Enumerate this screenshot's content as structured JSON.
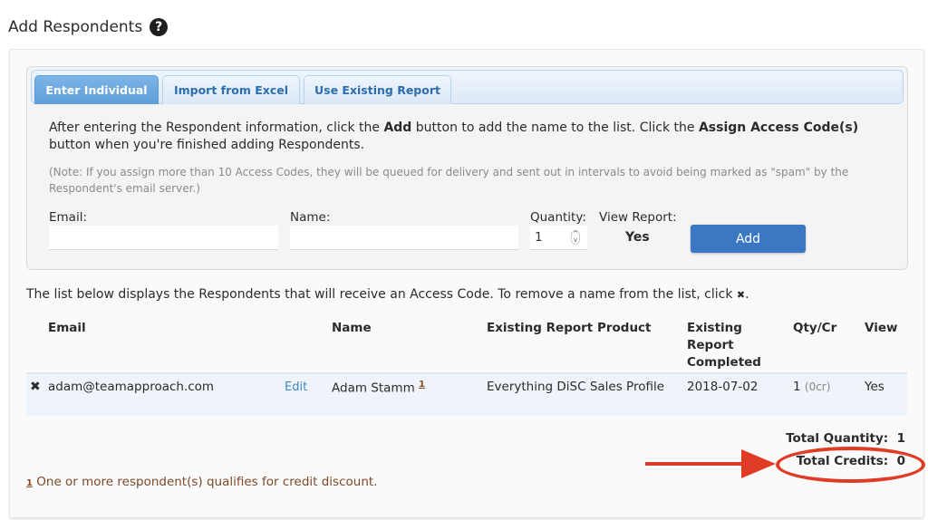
{
  "page": {
    "title": "Add Respondents",
    "help_icon": "question-circle-icon"
  },
  "tabs": [
    {
      "label": "Enter Individual",
      "active": true
    },
    {
      "label": "Import from Excel",
      "active": false
    },
    {
      "label": "Use Existing Report",
      "active": false
    }
  ],
  "instructions": {
    "part1": "After entering the Respondent information, click the ",
    "bold1": "Add",
    "part2": " button to add the name to the list. Click the ",
    "bold2": "Assign Access Code(s)",
    "part3": " button when you're finished adding Respondents.",
    "note": "(Note: If you assign more than 10 Access Codes, they will be queued for delivery and sent out in intervals to avoid being marked as \"spam\" by the Respondent's email server.)"
  },
  "form": {
    "email_label": "Email:",
    "email_value": "",
    "name_label": "Name:",
    "name_value": "",
    "quantity_label": "Quantity:",
    "quantity_value": "1",
    "view_report_label": "View Report:",
    "view_report_value": "Yes",
    "add_button": "Add"
  },
  "list": {
    "intro": "The list below displays the Respondents that will receive an Access Code. To remove a name from the list, click ",
    "intro_icon": "✖",
    "intro_end": ".",
    "columns": {
      "email": "Email",
      "name": "Name",
      "product": "Existing Report Product",
      "completed_1": "Existing",
      "completed_2": "Report",
      "completed_3": "Completed",
      "qty": "Qty/Cr",
      "view": "View"
    },
    "rows": [
      {
        "remove_icon": "✖",
        "email": "adam@teamapproach.com",
        "edit": "Edit",
        "name": "Adam Stamm",
        "footnote": "1",
        "product": "Everything DiSC Sales Profile",
        "completed": "2018-07-02",
        "qty": "1",
        "credits": "(0cr)",
        "view": "Yes"
      }
    ]
  },
  "totals": {
    "quantity_label": "Total Quantity:",
    "quantity_value": "1",
    "credits_label": "Total Credits:",
    "credits_value": "0"
  },
  "footnote": {
    "mark": "1",
    "text": " One or more respondent(s) qualifies for credit discount."
  },
  "colors": {
    "accent": "#3a78c4",
    "active_tab": "#5d9ed9",
    "annotation": "#e03c25",
    "footnote": "#7a4a2a"
  }
}
